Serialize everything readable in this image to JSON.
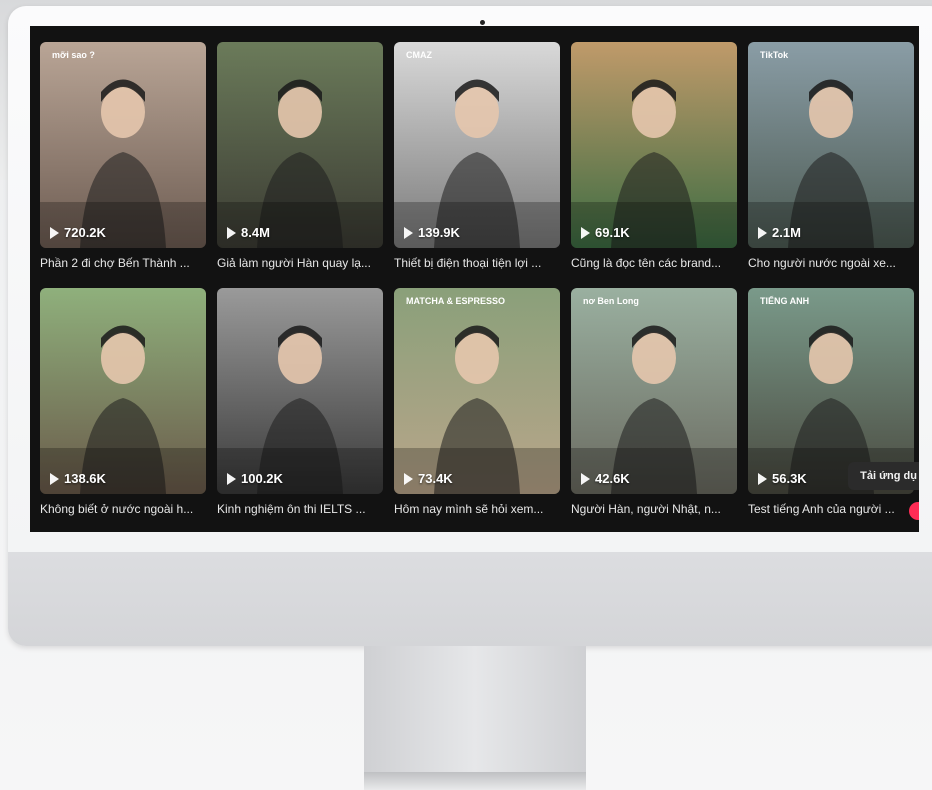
{
  "videos": [
    {
      "views": "720.2K",
      "caption": "Phần 2 đi chợ Bến Thành ...",
      "overlay": "mỡi sao ?",
      "bg": [
        "#b9a596",
        "#6d5c52"
      ]
    },
    {
      "views": "8.4M",
      "caption": "Giả làm người Hàn quay lạ...",
      "overlay": "",
      "bg": [
        "#6b7b5a",
        "#3b3b33"
      ]
    },
    {
      "views": "139.9K",
      "caption": "Thiết bị điện thoại tiện lợi ...",
      "overlay": "CMAZ",
      "bg": [
        "#d9d9d9",
        "#7a7a7a"
      ]
    },
    {
      "views": "69.1K",
      "caption": "Cũng là đọc tên các brand...",
      "overlay": "",
      "bg": [
        "#c09a6a",
        "#3c6c42"
      ]
    },
    {
      "views": "2.1M",
      "caption": "Cho người nước ngoài xe...",
      "overlay": "TikTok",
      "bg": [
        "#8a9da6",
        "#4c5a52"
      ]
    },
    {
      "views": "138.6K",
      "caption": "Không biết ở nước ngoài h...",
      "overlay": "",
      "bg": [
        "#8fb07c",
        "#6a5a4a"
      ]
    },
    {
      "views": "100.2K",
      "caption": "Kinh nghiệm ôn thi IELTS ...",
      "overlay": "",
      "bg": [
        "#9a9a9a",
        "#3a3a3a"
      ]
    },
    {
      "views": "73.4K",
      "caption": "Hôm nay mình sẽ hỏi xem...",
      "overlay": "MATCHA & ESPRESSO",
      "bg": [
        "#8aa07a",
        "#b9a58a"
      ]
    },
    {
      "views": "42.6K",
      "caption": "Người Hàn, người Nhật, n...",
      "overlay": "nơ Ben Long",
      "bg": [
        "#9ab0a0",
        "#6a6a60"
      ]
    },
    {
      "views": "56.3K",
      "caption": "Test tiếng Anh của người ...",
      "overlay": "TIẾNG ANH",
      "bg": [
        "#7a9a8a",
        "#4a4a40"
      ]
    }
  ],
  "app_button_label": "Tải ứng dụ"
}
